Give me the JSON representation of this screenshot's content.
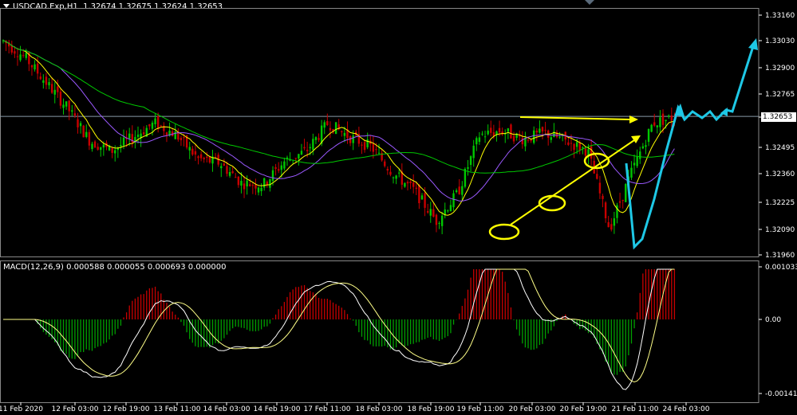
{
  "window": {
    "symbol_title": "USDCAD.Exp,H1",
    "ohlc": "1.32674 1.32675 1.32624 1.32653",
    "macd_title": "MACD(12,26,9) 0.000588 0.000055 0.000693 0.000000",
    "current_price_tag": "1.32653"
  },
  "colors": {
    "background": "#000000",
    "bull_candle": "#00c800",
    "bear_candle": "#c80000",
    "ma_fast": "#ffff00",
    "ma_mid": "#9b59ff",
    "ma_slow": "#00c800",
    "annotation_yellow": "#ffff00",
    "annotation_cyan": "#1ec8e6",
    "macd_hist_pos": "#c80000",
    "macd_hist_neg": "#00a000",
    "macd_signal": "#ffff88",
    "macd_line": "#ffffff"
  },
  "chart_data": [
    {
      "type": "candlestick",
      "title": "USDCAD.Exp,H1",
      "ylim": [
        1.3196,
        1.3316
      ],
      "y_ticks": [
        "1.33160",
        "1.33030",
        "1.32900",
        "1.32765",
        "1.32653",
        "1.32495",
        "1.32360",
        "1.32225",
        "1.32090",
        "1.31960"
      ],
      "x_ticks": [
        "11 Feb 2020",
        "12 Feb 03:00",
        "12 Feb 19:00",
        "13 Feb 11:00",
        "14 Feb 03:00",
        "14 Feb 19:00",
        "17 Feb 11:00",
        "18 Feb 03:00",
        "18 Feb 19:00",
        "19 Feb 11:00",
        "20 Feb 03:00",
        "20 Feb 19:00",
        "21 Feb 11:00",
        "24 Feb 03:00"
      ],
      "close_approx": [
        1.3303,
        1.3295,
        1.3282,
        1.3269,
        1.3253,
        1.3248,
        1.3255,
        1.3262,
        1.3256,
        1.3244,
        1.3242,
        1.3232,
        1.3231,
        1.3243,
        1.3248,
        1.3262,
        1.3255,
        1.325,
        1.3237,
        1.3228,
        1.3213,
        1.3227,
        1.3256,
        1.3258,
        1.3254,
        1.3257,
        1.3253,
        1.3248,
        1.3209,
        1.3237,
        1.3262,
        1.3265
      ],
      "current_price": 1.32653,
      "annotations": [
        "horizontal resistance arrow",
        "rising support arrow",
        "4 circled swing lows",
        "projected cyan path"
      ]
    },
    {
      "type": "macd",
      "title": "MACD(12,26,9)",
      "params": [
        12,
        26,
        9
      ],
      "ylim": [
        -0.001415,
        0.001033
      ],
      "y_ticks": [
        "0.001033",
        "0.00",
        "-0.001415"
      ]
    }
  ]
}
